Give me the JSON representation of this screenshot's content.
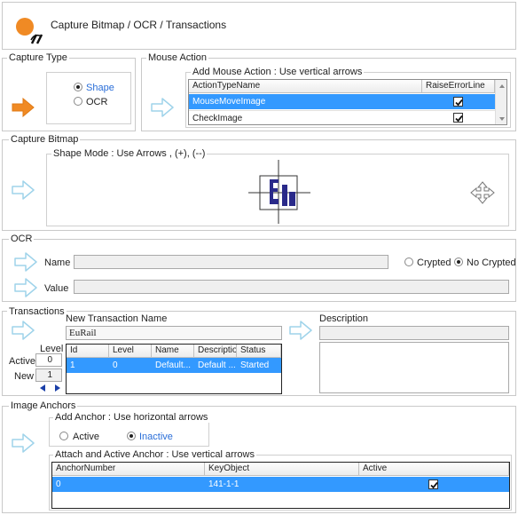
{
  "title": "Capture Bitmap / OCR / Transactions",
  "colors": {
    "selection": "#3399ff",
    "accent_orange": "#f08a24",
    "arrow_blue": "#bfe3f2"
  },
  "capture_type": {
    "legend": "Capture Type",
    "options": [
      "Shape",
      "OCR"
    ],
    "selected": "Shape"
  },
  "mouse_action": {
    "legend": "Mouse Action",
    "group_legend": "Add Mouse Action : Use vertical arrows",
    "columns": [
      "ActionTypeName",
      "RaiseErrorLine"
    ],
    "rows": [
      {
        "name": "MouseMoveImage",
        "raise": true
      },
      {
        "name": "CheckImage",
        "raise": true
      }
    ]
  },
  "capture_bitmap": {
    "legend": "Capture Bitmap",
    "group_legend": "Shape Mode : Use Arrows , (+), (--)"
  },
  "ocr": {
    "legend": "OCR",
    "name_label": "Name",
    "value_label": "Value",
    "options": [
      "Crypted",
      "No Crypted"
    ],
    "selected": "No Crypted",
    "name_value": "",
    "value_value": ""
  },
  "transactions": {
    "legend": "Transactions",
    "name_label": "New Transaction Name",
    "name_value": "EuRail",
    "description_label": "Description",
    "level_label": "Level",
    "active_label": "Active",
    "active_value": "0",
    "new_label": "New",
    "new_value": "1",
    "columns": [
      "Id",
      "Level",
      "Name",
      "Description",
      "Status"
    ],
    "rows": [
      {
        "id": "1",
        "level": "0",
        "name": "Default...",
        "description": "Default ...",
        "status": "Started"
      }
    ]
  },
  "image_anchors": {
    "legend": "Image Anchors",
    "add_legend": "Add Anchor  : Use horizontal arrows",
    "options": [
      "Active",
      "Inactive"
    ],
    "selected": "Inactive",
    "attach_legend": "Attach and Active Anchor : Use vertical arrows",
    "columns": [
      "AnchorNumber",
      "KeyObject",
      "Active"
    ],
    "rows": [
      {
        "anchor": "0",
        "key": "141-1-1",
        "active": true
      }
    ]
  }
}
